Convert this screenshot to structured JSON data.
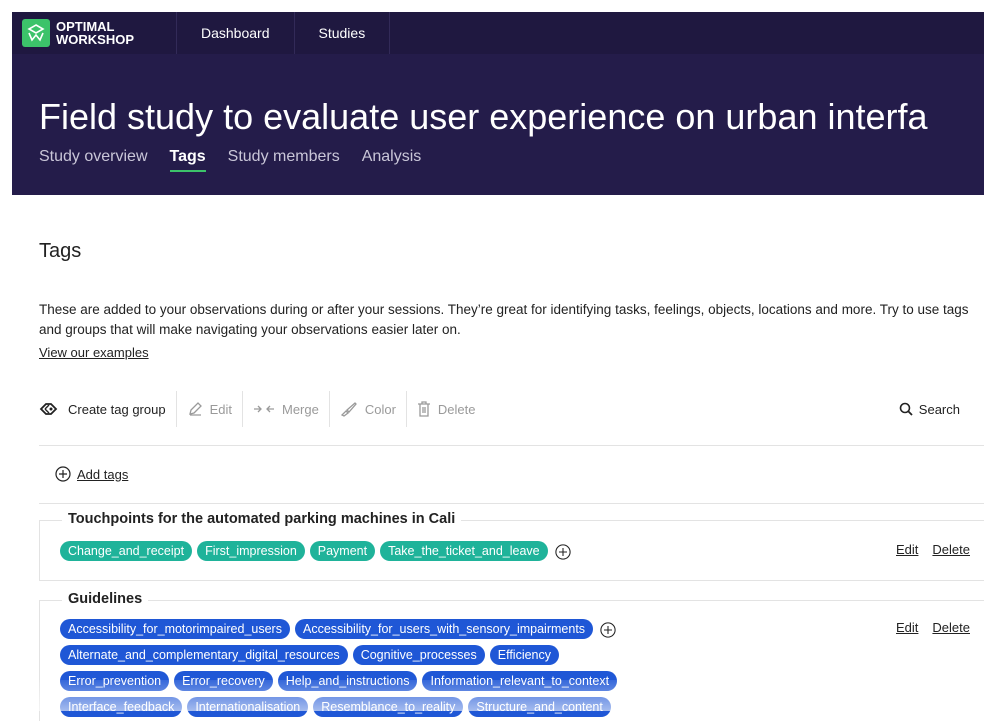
{
  "brand": {
    "line1": "OPTIMAL",
    "line2": "WORKSHOP"
  },
  "nav": {
    "dashboard": "Dashboard",
    "studies": "Studies"
  },
  "study": {
    "title": "Field study to evaluate user experience on urban interfa",
    "tabs": [
      "Study overview",
      "Tags",
      "Study members",
      "Analysis"
    ]
  },
  "page": {
    "title": "Tags",
    "description": "These are added to your observations during or after your sessions. They’re great for identifying tasks, feelings, objects, locations and more. Try to use tags and groups that will make navigating your observations easier later on.",
    "examples_link": "View our examples"
  },
  "toolbar": {
    "create": "Create tag group",
    "edit": "Edit",
    "merge": "Merge",
    "color": "Color",
    "delete": "Delete",
    "search": "Search"
  },
  "add_tags": "Add tags",
  "groups": [
    {
      "title": "Touchpoints for the automated parking machines in Cali",
      "color": "#1fb39a",
      "rows": [
        [
          "Change_and_receipt",
          "First_impression",
          "Payment",
          "Take_the_ticket_and_leave"
        ]
      ],
      "edit": "Edit",
      "delete": "Delete"
    },
    {
      "title": "Guidelines",
      "color": "#1f57d6",
      "rows": [
        [
          "Accessibility_for_motorimpaired_users",
          "Accessibility_for_users_with_sensory_impairments"
        ],
        [
          "Alternate_and_complementary_digital_resources",
          "Cognitive_processes",
          "Efficiency"
        ],
        [
          "Error_prevention",
          "Error_recovery",
          "Help_and_instructions",
          "Information_relevant_to_context"
        ],
        [
          "Interface_feedback",
          "Internationalisation",
          "Resemblance_to_reality",
          "Structure_and_content"
        ]
      ],
      "edit": "Edit",
      "delete": "Delete"
    }
  ]
}
